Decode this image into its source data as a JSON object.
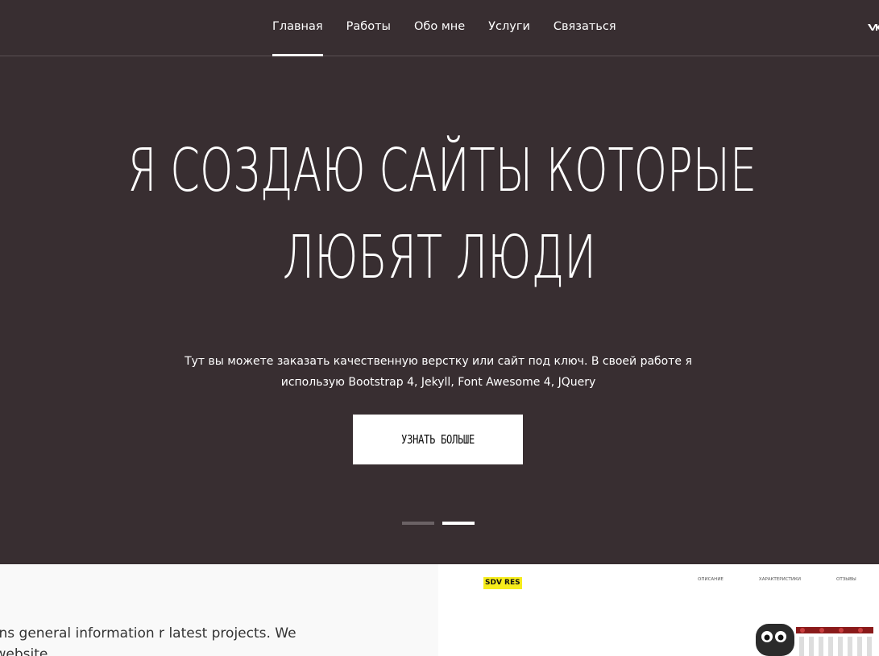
{
  "nav": {
    "items": [
      {
        "label": "Главная",
        "active": true
      },
      {
        "label": "Работы",
        "active": false
      },
      {
        "label": "Обо мне",
        "active": false
      },
      {
        "label": "Услуги",
        "active": false
      },
      {
        "label": "Связаться",
        "active": false
      }
    ],
    "social_icon": "vk-icon"
  },
  "hero": {
    "headline_line1": "Я СОЗДАЮ САЙТЫ КОТОРЫЕ",
    "headline_line2": "ЛЮБЯТ ЛЮДИ",
    "subtitle": "Тут вы можете заказать качественную верстку или сайт под ключ. В своей работе я использую Bootstrap 4, Jekyll, Font Awesome 4, JQuery",
    "cta_label": "УЗНАТЬ БОЛЬШЕ",
    "slides_total": 2,
    "active_slide": 2
  },
  "about": {
    "text": "te section contains general information r latest projects. We are focusing on website"
  },
  "preview": {
    "logo": "SDV RES",
    "nav": [
      "ОПИСАНИЕ",
      "ХАРАКТЕРИСТИКИ",
      "ОТЗЫВЫ"
    ]
  },
  "colors": {
    "hero_bg": "#382e31",
    "dot_inactive": "#6b6265",
    "dot_active": "#ffffff",
    "logo_highlight": "#f6ec1c"
  }
}
